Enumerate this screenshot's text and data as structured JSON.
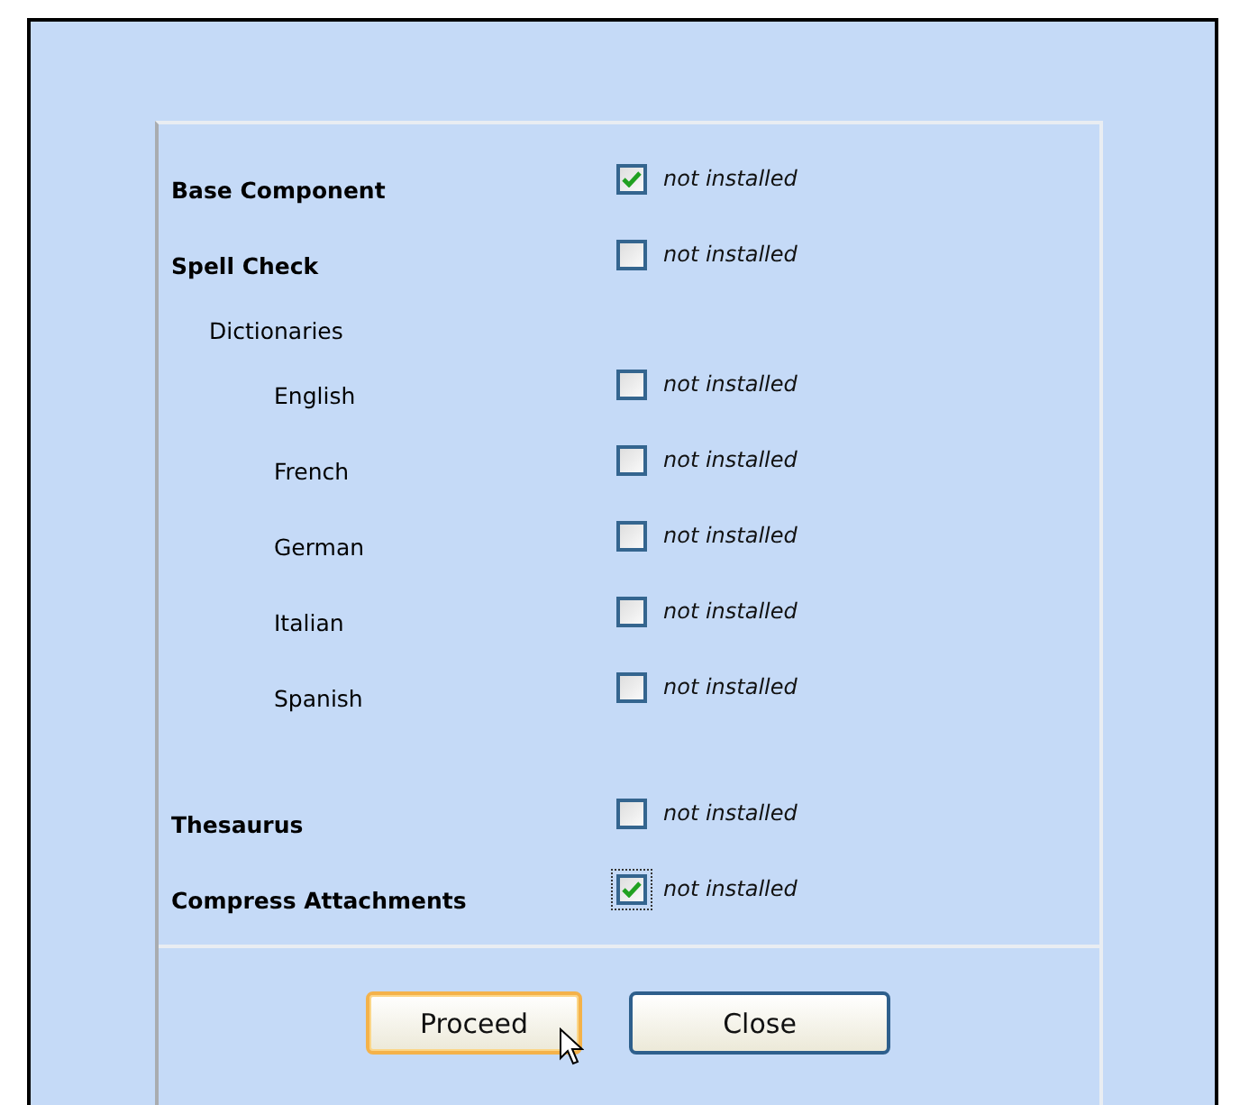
{
  "components": [
    {
      "kind": "component",
      "label": "Base Component",
      "checked": true,
      "focused": false,
      "status": "not installed"
    },
    {
      "kind": "component",
      "label": "Spell Check",
      "checked": false,
      "focused": false,
      "status": "not installed",
      "children": [
        {
          "kind": "group",
          "label": "Dictionaries",
          "children": [
            {
              "kind": "component",
              "label": "English",
              "checked": false,
              "focused": false,
              "status": "not installed"
            },
            {
              "kind": "component",
              "label": "French",
              "checked": false,
              "focused": false,
              "status": "not installed"
            },
            {
              "kind": "component",
              "label": "German",
              "checked": false,
              "focused": false,
              "status": "not installed"
            },
            {
              "kind": "component",
              "label": "Italian",
              "checked": false,
              "focused": false,
              "status": "not installed"
            },
            {
              "kind": "component",
              "label": "Spanish",
              "checked": false,
              "focused": false,
              "status": "not installed"
            }
          ]
        }
      ]
    },
    {
      "kind": "component",
      "label": "Thesaurus",
      "checked": false,
      "focused": false,
      "status": "not installed"
    },
    {
      "kind": "component",
      "label": "Compress Attachments",
      "checked": true,
      "focused": true,
      "status": "not installed"
    }
  ],
  "buttons": [
    {
      "label": "Proceed",
      "default": true
    },
    {
      "label": "Close",
      "default": false
    }
  ]
}
